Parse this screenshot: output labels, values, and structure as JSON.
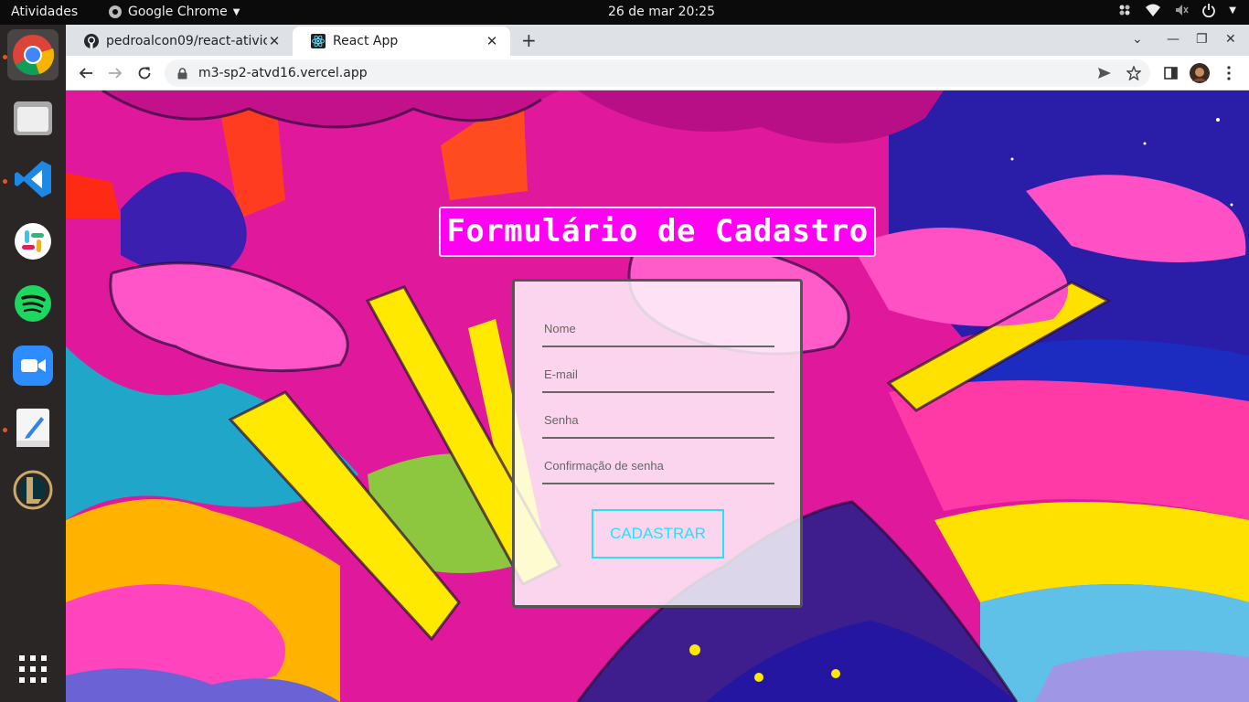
{
  "topbar": {
    "activities": "Atividades",
    "app_name": "Google Chrome",
    "clock": "26 de mar  20:25"
  },
  "dock": {
    "apps": [
      "chrome-icon",
      "files-icon",
      "vscode-icon",
      "slack-icon",
      "spotify-icon",
      "zoom-icon",
      "text-editor-icon",
      "league-of-legends-icon",
      "show-apps-icon"
    ]
  },
  "browser": {
    "tabs": [
      {
        "title": "pedroalcon09/react-ativic",
        "favicon": "github-icon"
      },
      {
        "title": "React App",
        "favicon": "react-icon"
      }
    ],
    "url": "m3-sp2-atvd16.vercel.app"
  },
  "page": {
    "title": "Formulário de Cadastro",
    "fields": [
      {
        "placeholder": "Nome"
      },
      {
        "placeholder": "E-mail"
      },
      {
        "placeholder": "Senha"
      },
      {
        "placeholder": "Confirmação de senha"
      }
    ],
    "submit_label": "CADASTRAR"
  },
  "colors": {
    "title_bg": "#ff00f0",
    "button_accent": "#22e3ff",
    "ubuntu_orange": "#e95420"
  }
}
